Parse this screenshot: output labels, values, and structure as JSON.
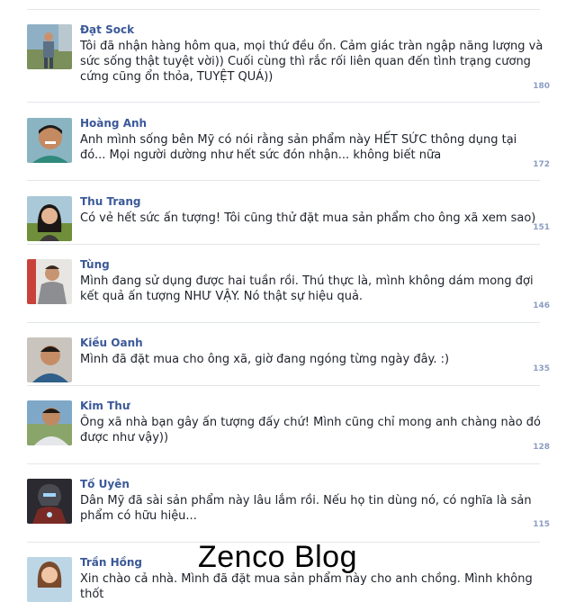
{
  "comments": [
    {
      "name": "Đạt Sock",
      "text": "Tôi đã nhận hàng hôm qua, mọi thứ đều ổn. Cảm giác tràn ngập năng lượng và sức sống thật tuyệt vời)) Cuối cùng thì rắc rối liên quan đến tình trạng cương cứng cũng ổn thỏa, TUYỆT QUÁ))",
      "count": "180",
      "avatar_icon": "person-outdoor-photo-icon"
    },
    {
      "name": "Hoàng Anh",
      "text": "Anh mình sống bên Mỹ có nói rằng sản phẩm này HẾT SỨC thông dụng tại đó... Mọi người dường như hết sức đón nhận... không biết nữa",
      "count": "172",
      "avatar_icon": "man-smiling-photo-icon"
    },
    {
      "name": "Thu Trang",
      "text": "Có vẻ hết sức ấn tượng! Tôi cũng thử đặt mua sản phẩm cho ông xã xem sao)",
      "count": "151",
      "avatar_icon": "woman-portrait-photo-icon"
    },
    {
      "name": "Tùng",
      "text": "Mình đang sử dụng được hai tuần rồi. Thú thực là, mình không dám mong đợi kết quả ấn tượng NHƯ VẬY. Nó thật sự hiệu quả.",
      "count": "146",
      "avatar_icon": "man-grey-shirt-photo-icon"
    },
    {
      "name": "Kiều Oanh",
      "text": "Mình đã đặt mua cho ông xã, giờ đang ngóng từng ngày đây. :)",
      "count": "135",
      "avatar_icon": "man-portrait-photo-icon"
    },
    {
      "name": "Kim Thư",
      "text": "Ông xã nhà bạn gây ấn tượng đấy chứ! Mình cũng chỉ mong anh chàng nào đó được như vậy))",
      "count": "128",
      "avatar_icon": "man-outdoor-photo-icon"
    },
    {
      "name": "Tố Uyên",
      "text": "Dân Mỹ đã sài sản phẩm này lâu lắm rồi. Nếu họ tin dùng nó, có nghĩa là sản phẩm có hữu hiệu...",
      "count": "115",
      "avatar_icon": "armored-hero-photo-icon"
    },
    {
      "name": "Trần Hồng",
      "text": "Xin chào cả nhà. Mình đã đặt mua sản phẩm này cho anh chồng. Mình không thốt",
      "count": "",
      "avatar_icon": "woman-smiling-photo-icon"
    }
  ],
  "watermark": "Zenco Blog"
}
